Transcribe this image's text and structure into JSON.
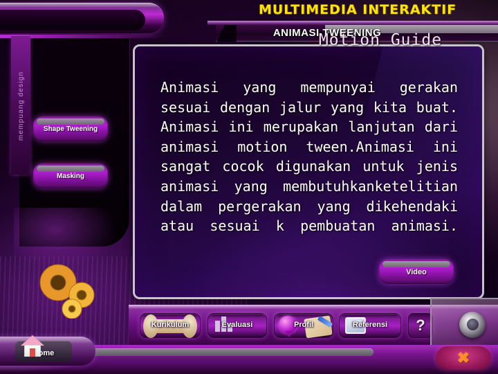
{
  "header": {
    "app_title": "MULTIMEDIA INTERAKTIF",
    "section_title": "ANIMASI TWEENING"
  },
  "sidebar": {
    "spine_label": "mempuang design",
    "items": [
      {
        "label": "Shape Tweening"
      },
      {
        "label": "Masking"
      }
    ]
  },
  "content": {
    "heading": "Motion\nGuide",
    "body": "Animasi yang mempunyai gerakan sesuai dengan jalur yang kita buat. Animasi ini merupakan lanjutan dari animasi motion tween.Animasi ini sangat cocok digunakan untuk jenis animasi yang membutuhkanketelitian dalam pergerakan yang dikehendaki atau sesuai k pembuatan animasi.",
    "video_button": "Video"
  },
  "nav": {
    "items": [
      {
        "label": "Kurikulum",
        "icon": "bone-icon"
      },
      {
        "label": "Evaluasi",
        "icon": "bar-chart-icon"
      },
      {
        "label": "Profil",
        "icon": "balloon-icon"
      },
      {
        "label": "Referensi",
        "icon": "monitor-icon"
      }
    ],
    "help_label": "?"
  },
  "footer": {
    "home_label": "Home",
    "home_icon": "house-icon",
    "close_label": "✖",
    "close_icon": "close-x-icon",
    "knob_icon": "dial-knob-icon"
  },
  "colors": {
    "accent_purple": "#a81fc6",
    "title_yellow": "#ffe400",
    "panel_dark": "#1b0530",
    "text_white": "#ffffff",
    "close_orange": "#ff8a2a"
  }
}
